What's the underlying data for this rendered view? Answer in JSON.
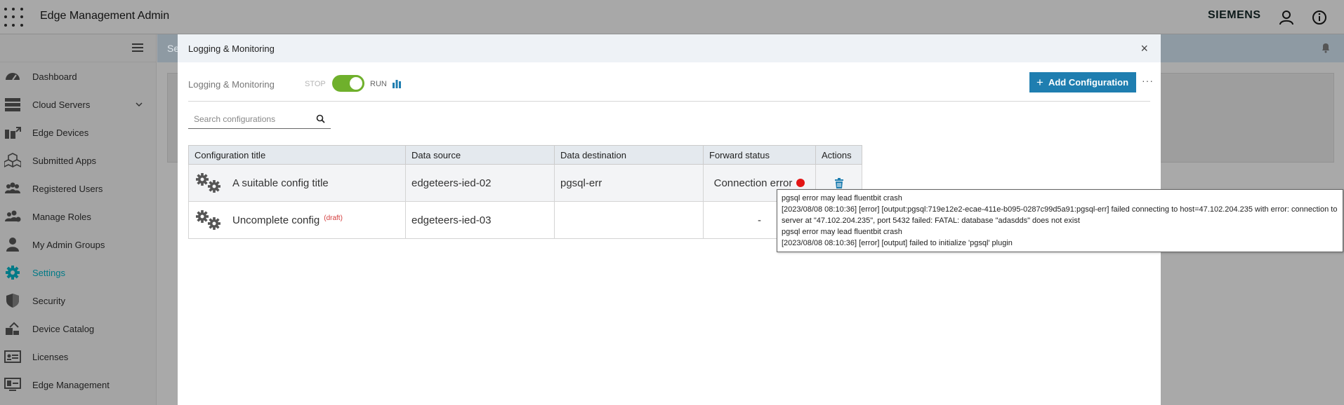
{
  "header": {
    "app_title": "Edge Management Admin",
    "brand": "SIEMENS",
    "icons": [
      "apps-grid-icon",
      "user-icon",
      "info-icon"
    ]
  },
  "sidebar": {
    "items": [
      {
        "label": "Dashboard",
        "icon": "dashboard-icon"
      },
      {
        "label": "Cloud Servers",
        "icon": "server-icon",
        "expandable": true
      },
      {
        "label": "Edge Devices",
        "icon": "devices-icon"
      },
      {
        "label": "Submitted Apps",
        "icon": "apps-icon"
      },
      {
        "label": "Registered Users",
        "icon": "users-icon"
      },
      {
        "label": "Manage Roles",
        "icon": "roles-icon"
      },
      {
        "label": "My Admin Groups",
        "icon": "user-icon"
      },
      {
        "label": "Settings",
        "icon": "gear-icon",
        "active": true
      },
      {
        "label": "Security",
        "icon": "shield-icon"
      },
      {
        "label": "Device Catalog",
        "icon": "catalog-icon"
      },
      {
        "label": "Licenses",
        "icon": "license-icon"
      },
      {
        "label": "Edge Management",
        "icon": "monitor-icon"
      }
    ]
  },
  "background_page": {
    "header_initial": "Se"
  },
  "modal": {
    "title": "Logging & Monitoring",
    "close_label": "×",
    "toolbar": {
      "label": "Logging & Monitoring",
      "stop_label": "STOP",
      "run_label": "RUN",
      "toggle_state": "run",
      "add_button_label": "Add Configuration",
      "more_label": "···"
    },
    "search": {
      "placeholder": "Search configurations",
      "value": ""
    },
    "table": {
      "headers": [
        "Configuration title",
        "Data source",
        "Data destination",
        "Forward status",
        "Actions"
      ],
      "rows": [
        {
          "title": "A suitable config title",
          "draft_tag": "",
          "data_source": "edgeteers-ied-02",
          "data_destination": "pgsql-err",
          "forward_status": "Connection error",
          "status_color": "#e31414"
        },
        {
          "title": "Uncomplete config",
          "draft_tag": "(draft)",
          "data_source": "edgeteers-ied-03",
          "data_destination": "",
          "forward_status": "-"
        }
      ]
    },
    "tooltip": {
      "lines": [
        "pgsql error may lead fluentbit crash",
        "[2023/08/08 08:10:36] [error] [output:pgsql:719e12e2-ecae-411e-b095-0287c99d5a91:pgsql-err] failed connecting to host=47.102.204.235 with error: connection to server at \"47.102.204.235\", port 5432 failed: FATAL:  database \"adasdds\" does not exist",
        "pgsql error may lead fluentbit crash",
        "[2023/08/08 08:10:36] [error] [output] failed to initialize 'pgsql' plugin"
      ]
    }
  },
  "colors": {
    "accent": "#1f7eb0",
    "toggle_on": "#6fb02c",
    "error": "#e31414",
    "active_nav": "#007a87"
  }
}
